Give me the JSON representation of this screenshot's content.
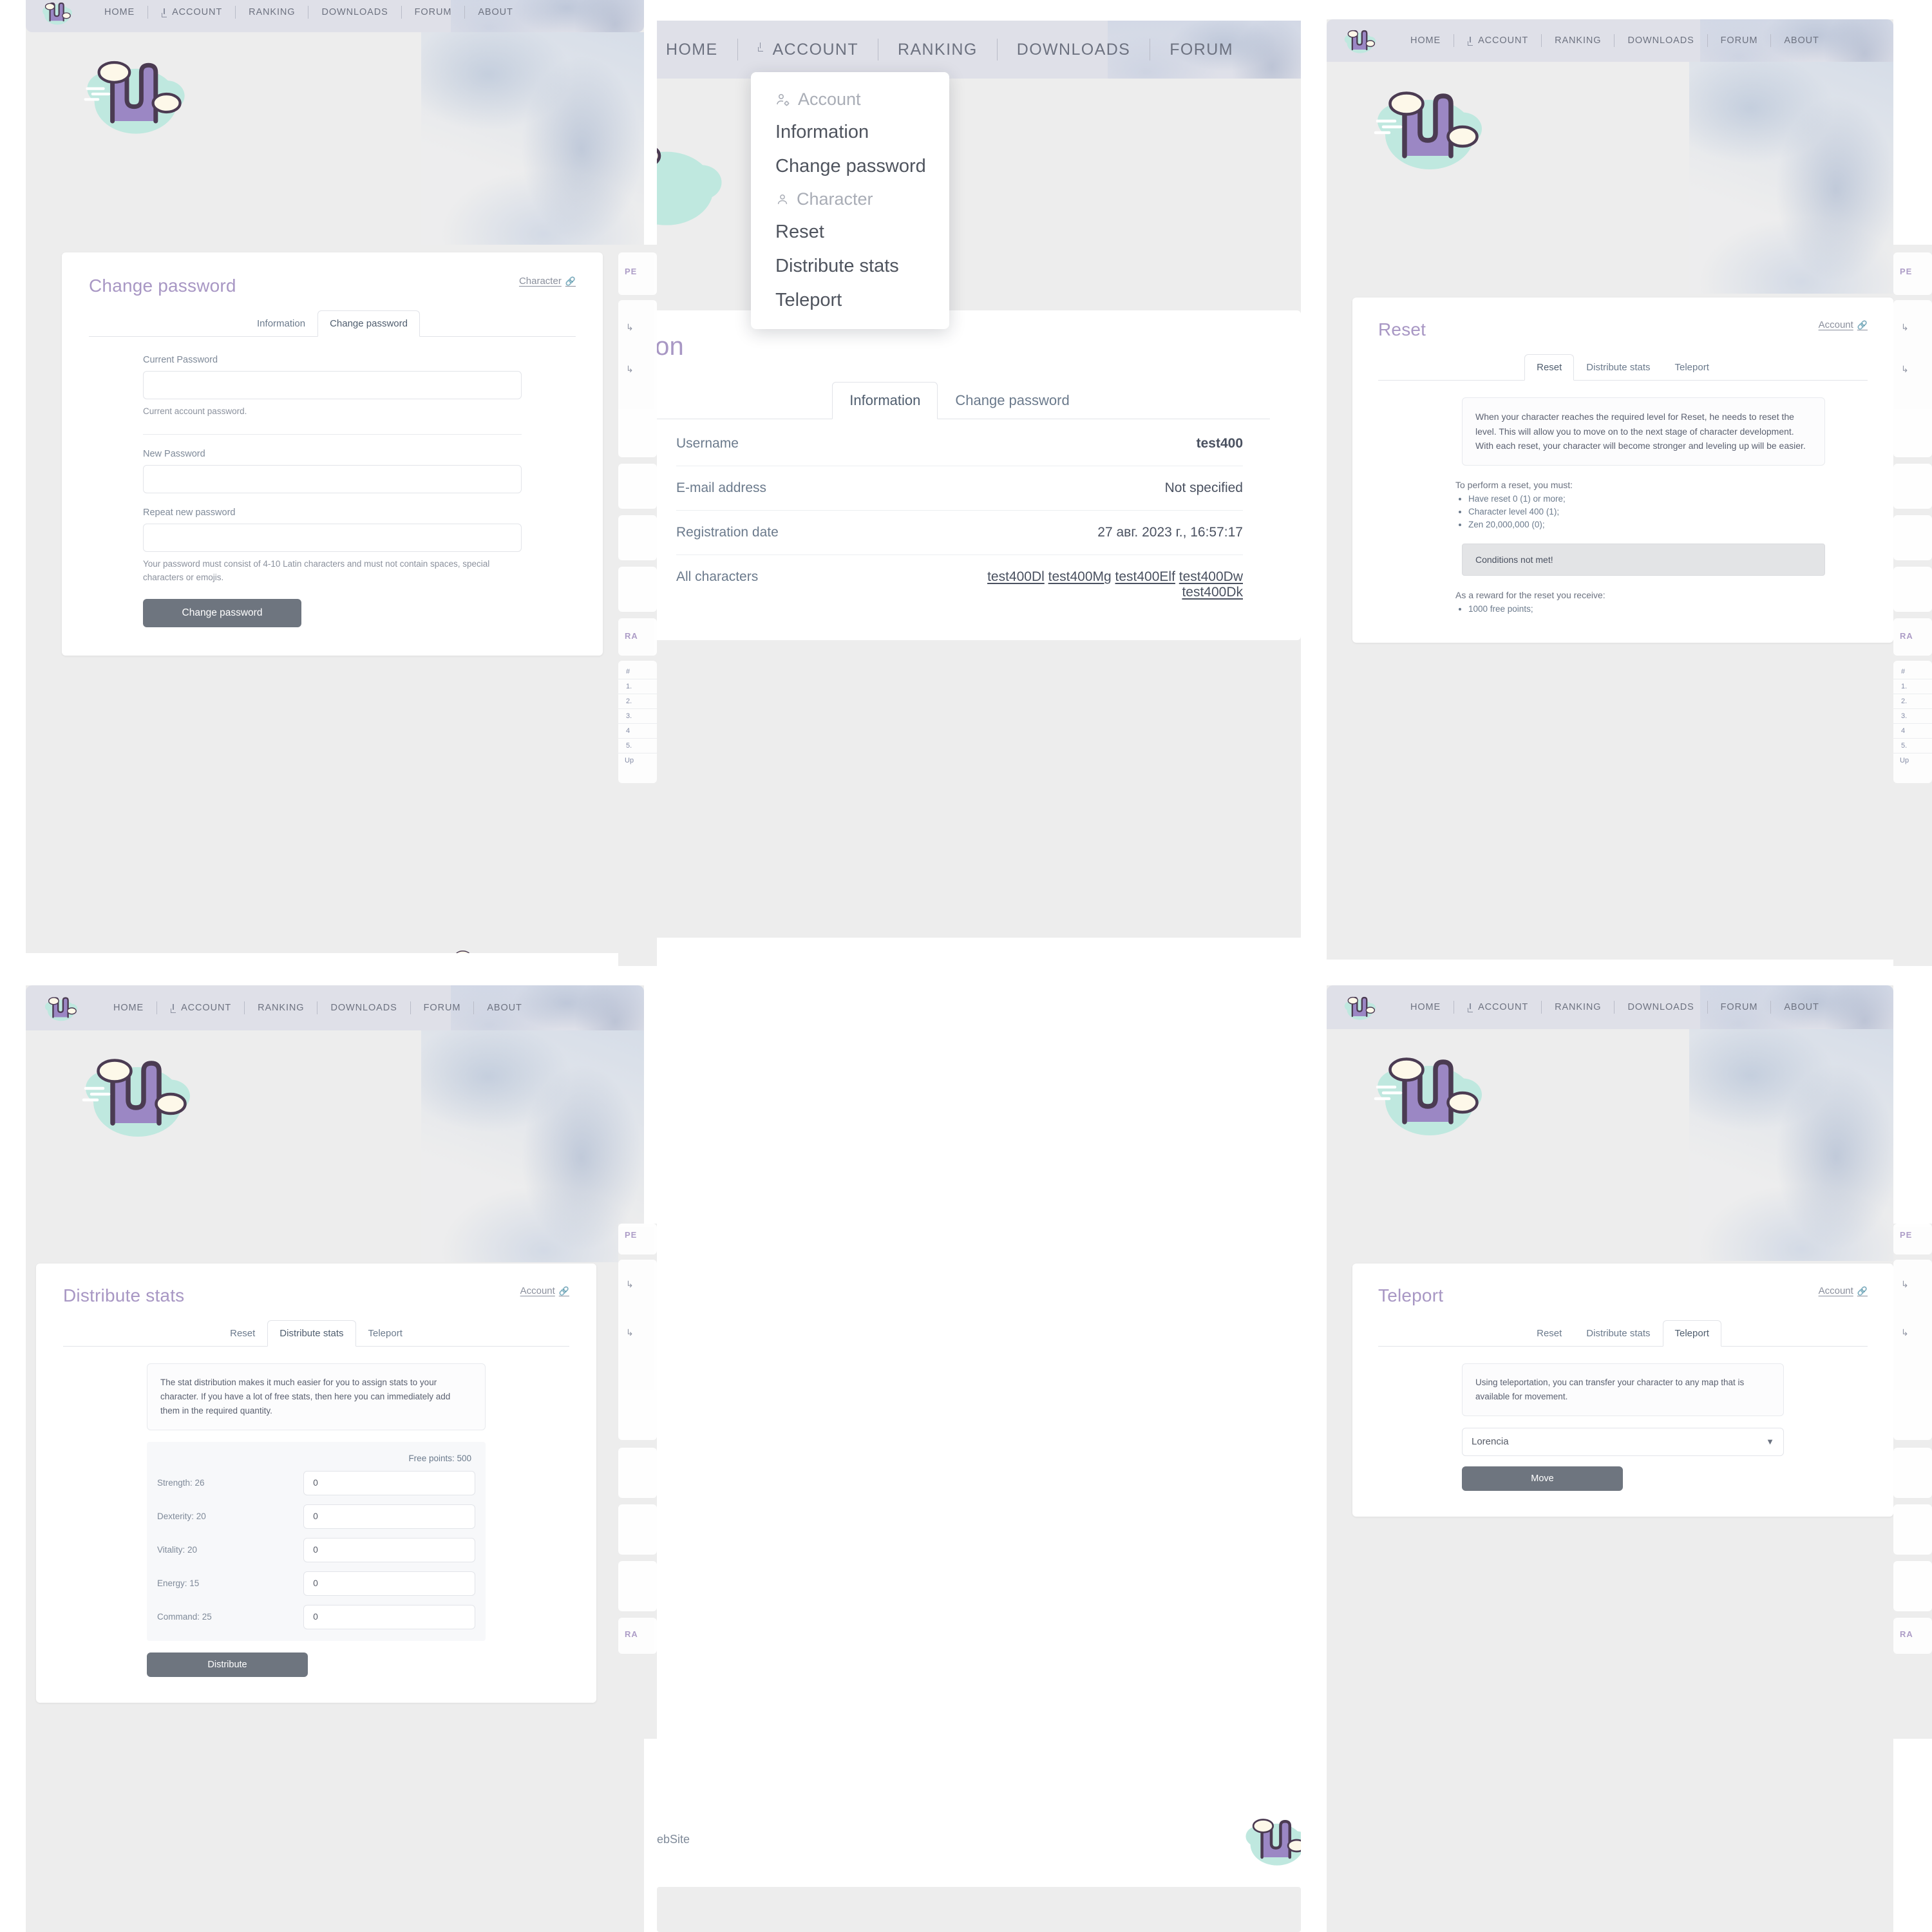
{
  "site": {
    "nav": {
      "items": [
        {
          "label": "HOME",
          "icon": null
        },
        {
          "label": "ACCOUNT",
          "icon": "account-arrow-icon"
        },
        {
          "label": "RANKING",
          "icon": null
        },
        {
          "label": "DOWNLOADS",
          "icon": null
        },
        {
          "label": "FORUM",
          "icon": null
        },
        {
          "label": "ABOUT",
          "icon": null
        }
      ]
    },
    "logo_alt": "mu-logo",
    "footer": {
      "text": "ebSite"
    }
  },
  "dropdown": {
    "groups": [
      {
        "header": "Account",
        "header_icon": "account-gear-icon",
        "items": [
          "Information",
          "Change password"
        ]
      },
      {
        "header": "Character",
        "header_icon": "person-icon",
        "items": [
          "Reset",
          "Distribute stats",
          "Teleport"
        ]
      }
    ]
  },
  "change_password": {
    "title": "Change password",
    "breadcrumb": "Character",
    "breadcrumb_icon": "link-icon",
    "tabs": [
      {
        "label": "Information",
        "active": false
      },
      {
        "label": "Change password",
        "active": true
      }
    ],
    "fields": [
      {
        "label": "Current Password",
        "value": "",
        "hint": "Current account password."
      },
      {
        "label": "New Password",
        "value": "",
        "hint": ""
      },
      {
        "label": "Repeat new password",
        "value": "",
        "hint": "Your password must consist of 4-10 Latin characters and must not contain spaces, special characters or emojis."
      }
    ],
    "submit_label": "Change password"
  },
  "information": {
    "title_fragment": "ion",
    "tabs": [
      {
        "label": "Information",
        "active": true
      },
      {
        "label": "Change password",
        "active": false
      }
    ],
    "rows": [
      {
        "key": "Username",
        "value": "test400",
        "bold": true,
        "links": null
      },
      {
        "key": "E-mail address",
        "value": "Not specified",
        "bold": false,
        "links": null
      },
      {
        "key": "Registration date",
        "value": "27 авг. 2023 г., 16:57:17",
        "bold": false,
        "links": null
      },
      {
        "key": "All characters",
        "value": "",
        "bold": false,
        "links": [
          "test400Dl",
          "test400Mg",
          "test400Elf",
          "test400Dw",
          "test400Dk"
        ]
      }
    ]
  },
  "reset": {
    "title": "Reset",
    "breadcrumb": "Account",
    "breadcrumb_icon": "link-icon",
    "tabs": [
      {
        "label": "Reset",
        "active": true
      },
      {
        "label": "Distribute stats",
        "active": false
      },
      {
        "label": "Teleport",
        "active": false
      }
    ],
    "notice": "When your character reaches the required level for Reset, he needs to reset the level. This will allow you to move on to the next stage of character development. With each reset, your character will become stronger and leveling up will be easier.",
    "requirements_title": "To perform a reset, you must:",
    "requirements": [
      "Have reset 0 (1) or more;",
      "Character level 400 (1);",
      "Zen 20,000,000 (0);"
    ],
    "alert": "Conditions not met!",
    "reward_title": "As a reward for the reset you receive:",
    "rewards": [
      "1000 free points;"
    ]
  },
  "distribute": {
    "title": "Distribute stats",
    "breadcrumb": "Account",
    "breadcrumb_icon": "link-icon",
    "tabs": [
      {
        "label": "Reset",
        "active": false
      },
      {
        "label": "Distribute stats",
        "active": true
      },
      {
        "label": "Teleport",
        "active": false
      }
    ],
    "notice": "The stat distribution makes it much easier for you to assign stats to your character. If you have a lot of free stats, then here you can immediately add them in the required quantity.",
    "free_points_label": "Free points: 500",
    "stats": [
      {
        "label": "Strength: 26",
        "value": "0"
      },
      {
        "label": "Dexterity: 20",
        "value": "0"
      },
      {
        "label": "Vitality: 20",
        "value": "0"
      },
      {
        "label": "Energy: 15",
        "value": "0"
      },
      {
        "label": "Command: 25",
        "value": "0"
      }
    ],
    "submit_label": "Distribute"
  },
  "teleport": {
    "title": "Teleport",
    "breadcrumb": "Account",
    "breadcrumb_icon": "link-icon",
    "tabs": [
      {
        "label": "Reset",
        "active": false
      },
      {
        "label": "Distribute stats",
        "active": false
      },
      {
        "label": "Teleport",
        "active": true
      }
    ],
    "notice": "Using teleportation, you can transfer your character to any map that is available for movement.",
    "map_selected": "Lorencia",
    "submit_label": "Move"
  },
  "stubs": {
    "personal_label": "PE",
    "ranking_label": "RA",
    "rank_rows": [
      "#",
      "1.",
      "2.",
      "3.",
      "4",
      "5.",
      "Up"
    ]
  },
  "colors": {
    "accent_purple": "#a897c4",
    "nav_bg": "#dfe0e8",
    "page_bg": "#ededed",
    "button": "#6e757f",
    "text": "#6b7280",
    "logo_purple": "#9b87c4",
    "logo_mint": "#bfe8df"
  }
}
